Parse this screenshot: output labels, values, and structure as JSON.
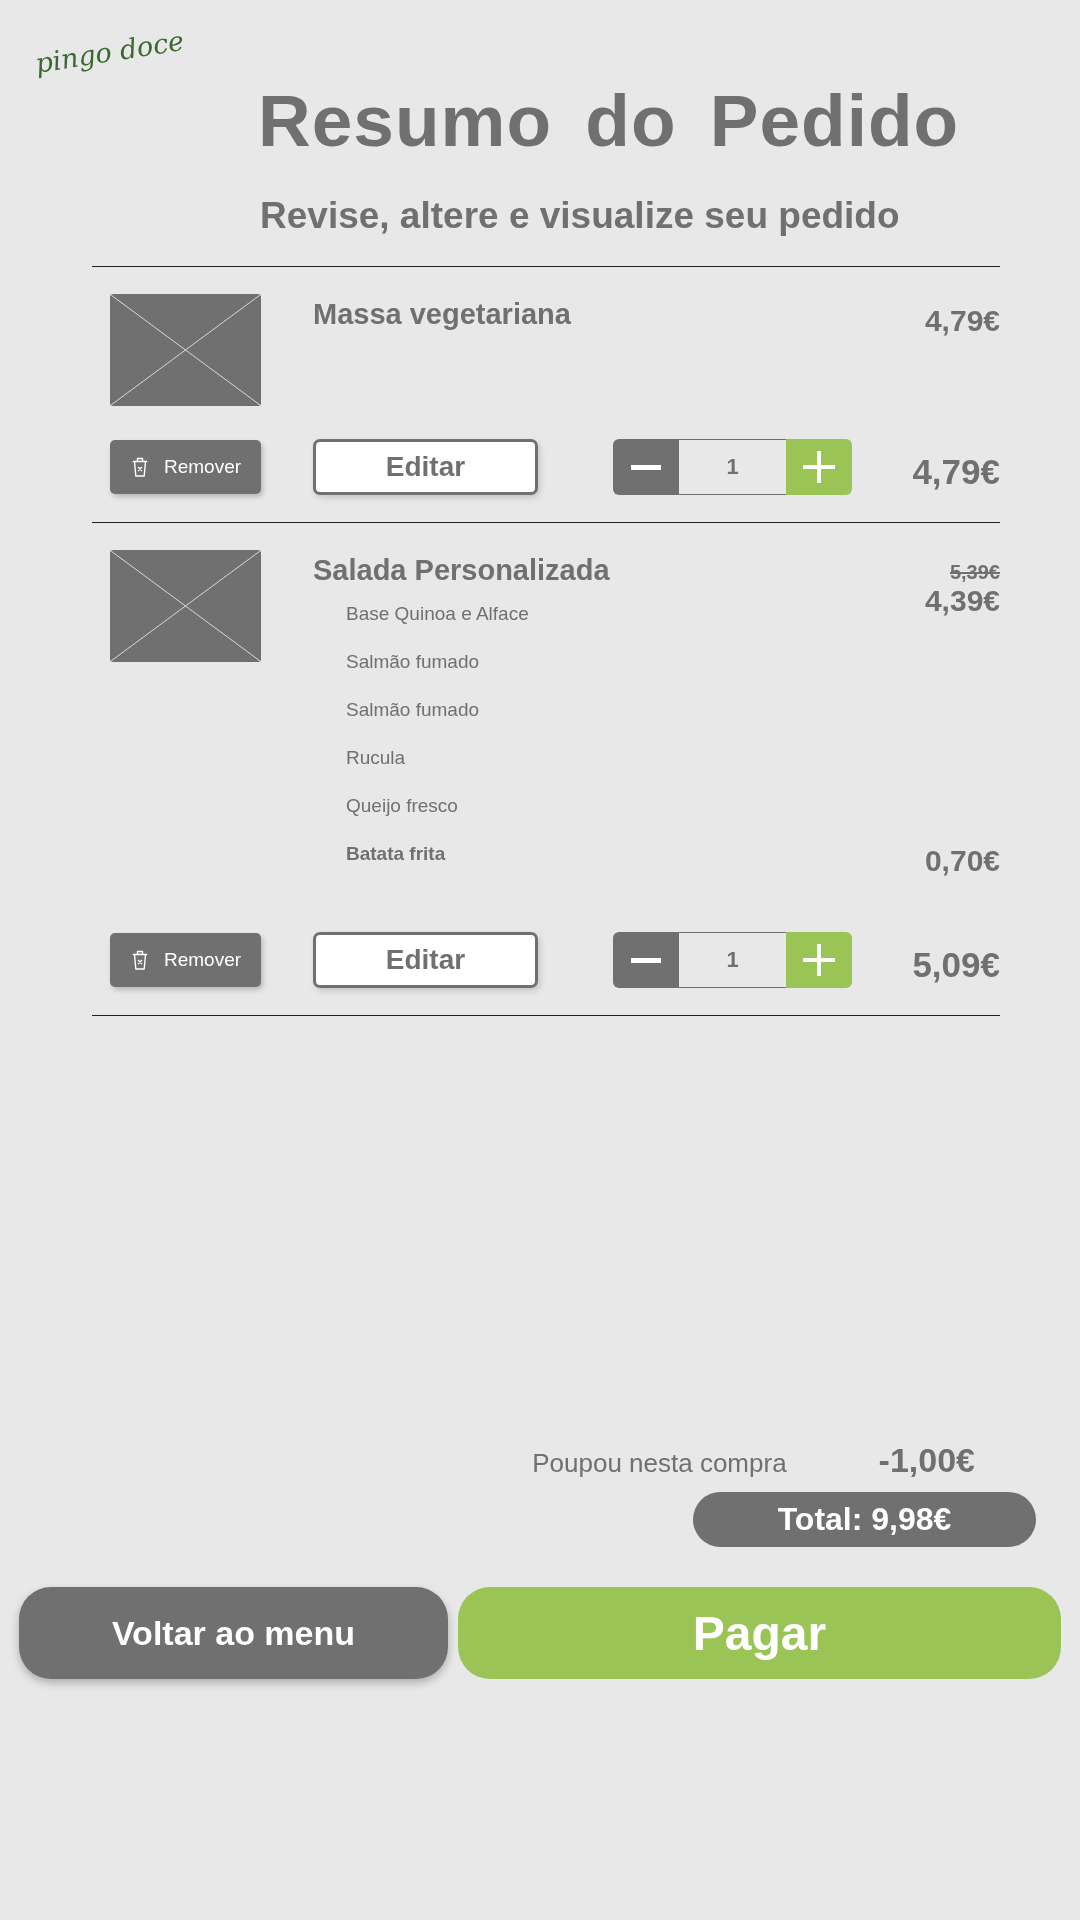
{
  "logo": {
    "text": "pingo doce"
  },
  "header": {
    "title": "Resumo do Pedido",
    "subtitle": "Revise, altere e visualize seu pedido"
  },
  "items": [
    {
      "name": "Massa vegetariana",
      "price": "4,79€",
      "remove_label": "Remover",
      "edit_label": "Editar",
      "quantity": "1",
      "line_total": "4,79€"
    },
    {
      "name": "Salada Personalizada",
      "old_price": "5,39€",
      "price": "4,39€",
      "options": [
        {
          "kind": "included",
          "text": "Base Quinoa e Alface"
        },
        {
          "kind": "included",
          "text": "Salmão fumado"
        },
        {
          "kind": "included",
          "text": "Salmão fumado"
        },
        {
          "kind": "included",
          "text": "Rucula"
        },
        {
          "kind": "included",
          "text": "Queijo fresco"
        },
        {
          "kind": "extra",
          "text": "Batata frita",
          "price": "0,70€"
        }
      ],
      "remove_label": "Remover",
      "edit_label": "Editar",
      "quantity": "1",
      "line_total": "5,09€"
    }
  ],
  "summary": {
    "savings_label": "Poupou nesta compra",
    "savings": "-1,00€",
    "total": "Total: 9,98€"
  },
  "actions": [
    {
      "kind": "secondary",
      "label": "Voltar ao menu"
    },
    {
      "kind": "primary",
      "label": "Pagar"
    }
  ]
}
